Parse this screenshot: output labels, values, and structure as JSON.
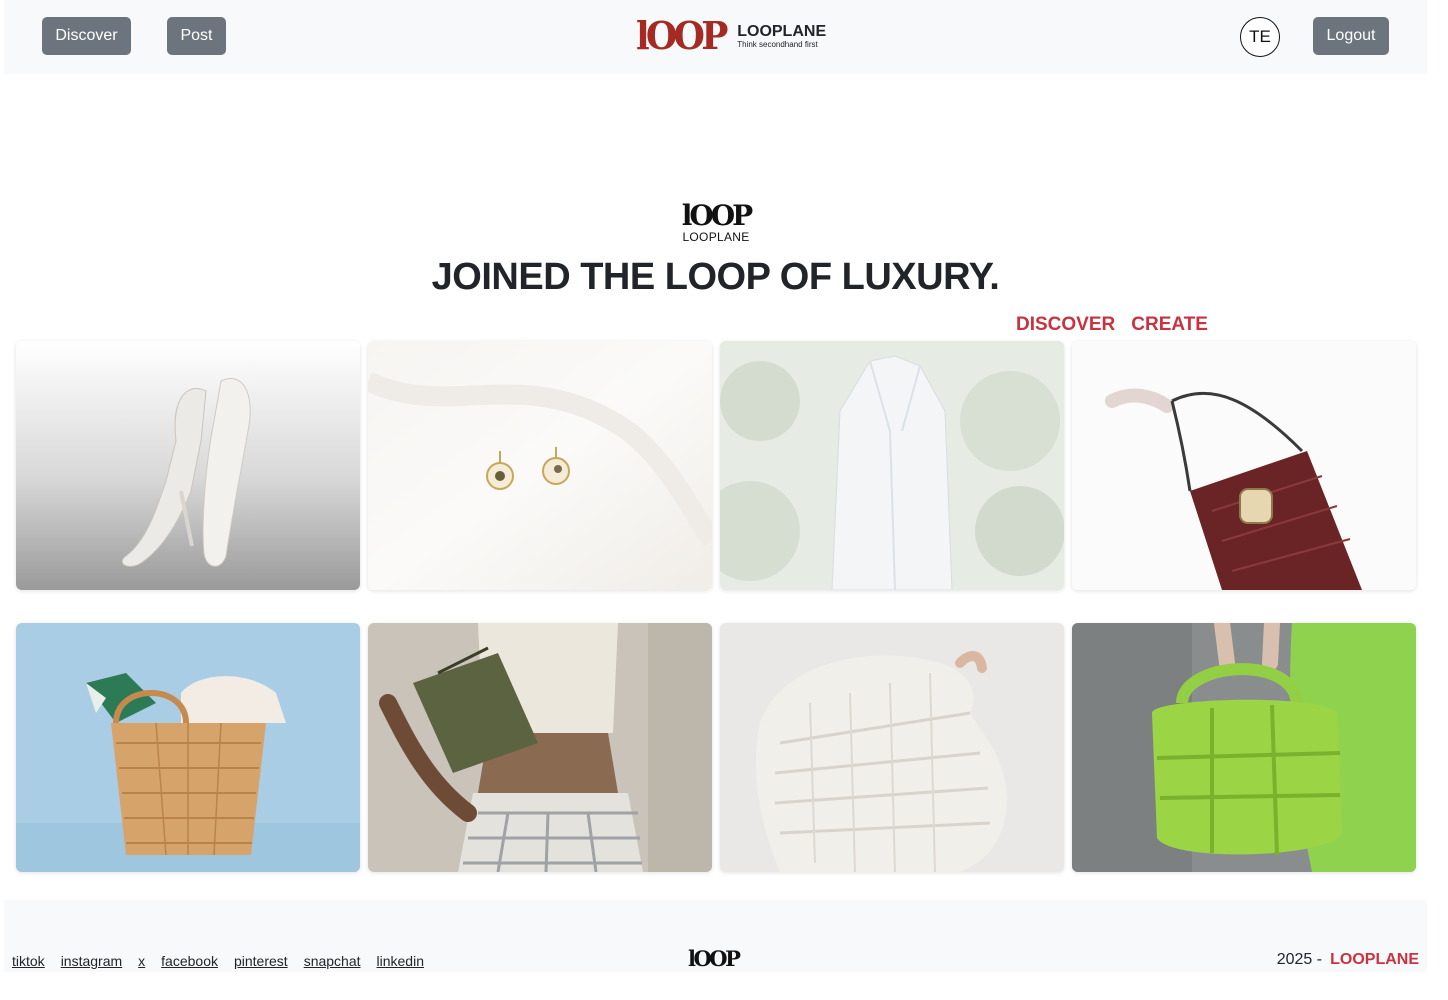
{
  "navbar": {
    "discover_label": "Discover",
    "post_label": "Post",
    "logout_label": "Logout",
    "avatar_initials": "TE",
    "brand": {
      "mark": "lOOP",
      "name": "LOOPLANE",
      "tagline": "Think secondhand first",
      "color": "#a52a23"
    }
  },
  "hero": {
    "logo_mark": "lOOP",
    "logo_name": "LOOPLANE",
    "headline": "JOINED THE LOOP OF LUXURY.",
    "links": {
      "discover": "DISCOVER",
      "create": "CREATE"
    },
    "accent_color": "#c9333f"
  },
  "gallery": {
    "items": [
      {
        "icon": "white-heels-image"
      },
      {
        "icon": "earrings-image"
      },
      {
        "icon": "blazer-image"
      },
      {
        "icon": "handbag-image"
      },
      {
        "icon": "straw-basket-image"
      },
      {
        "icon": "olive-bag-outfit-image"
      },
      {
        "icon": "knit-sweater-image"
      },
      {
        "icon": "green-puffer-bag-image"
      }
    ]
  },
  "footer": {
    "social": [
      "tiktok",
      "instagram",
      "x",
      "facebook",
      "pinterest",
      "snapchat",
      "linkedin"
    ],
    "logo_mark": "lOOP",
    "year": "2025 -",
    "brand": "LOOPLANE"
  }
}
